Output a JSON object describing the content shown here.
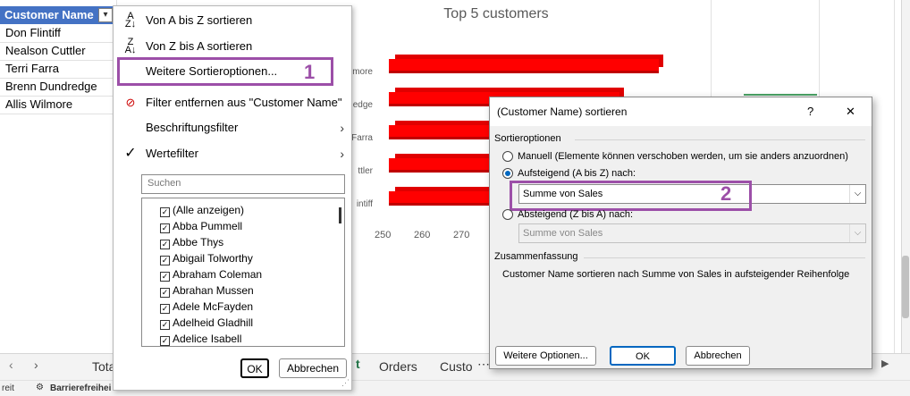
{
  "sheet": {
    "header": "Customer Name",
    "names": [
      "Don Flintiff",
      "Nealson Cuttler",
      "Terri Farra",
      "Brenn Dundredge",
      "Allis Wilmore"
    ],
    "tabs": [
      "Tota",
      "Orders",
      "Custo"
    ],
    "status_left": "reit",
    "status_access": "Barrierefreihei"
  },
  "chart": {
    "title": "Top 5 customers",
    "labels": [
      "more",
      "edge",
      "Farra",
      "ttler",
      "intiff"
    ],
    "ticks": [
      "250",
      "260",
      "270"
    ]
  },
  "menu": {
    "sort_az": "Von A bis Z sortieren",
    "sort_za": "Von Z bis A sortieren",
    "more_sort": "Weitere Sortieroptionen...",
    "remove_filter": "Filter entfernen aus \"Customer Name\"",
    "label_filter": "Beschriftungsfilter",
    "value_filter": "Wertefilter",
    "search_placeholder": "Suchen",
    "items": [
      "(Alle anzeigen)",
      "Abba Pummell",
      "Abbe Thys",
      "Abigail Tolworthy",
      "Abraham Coleman",
      "Abrahan Mussen",
      "Adele McFayden",
      "Adelheid Gladhill",
      "Adelice Isabell"
    ],
    "ok": "OK",
    "cancel": "Abbrechen",
    "badge1": "1"
  },
  "dialog": {
    "title": "(Customer Name) sortieren",
    "help": "?",
    "close": "✕",
    "section_options": "Sortieroptionen",
    "opt_manual": "Manuell (Elemente können verschoben werden, um sie anders anzuordnen)",
    "opt_asc": "Aufsteigend (A bis Z) nach:",
    "asc_value": "Summe von Sales",
    "opt_desc": "Absteigend (Z bis A) nach:",
    "desc_value": "Summe von Sales",
    "section_summary": "Zusammenfassung",
    "summary_text": "Customer Name sortieren nach Summe von Sales in aufsteigender Reihenfolge",
    "more_options": "Weitere Optionen...",
    "ok": "OK",
    "cancel": "Abbrechen",
    "badge2": "2"
  }
}
